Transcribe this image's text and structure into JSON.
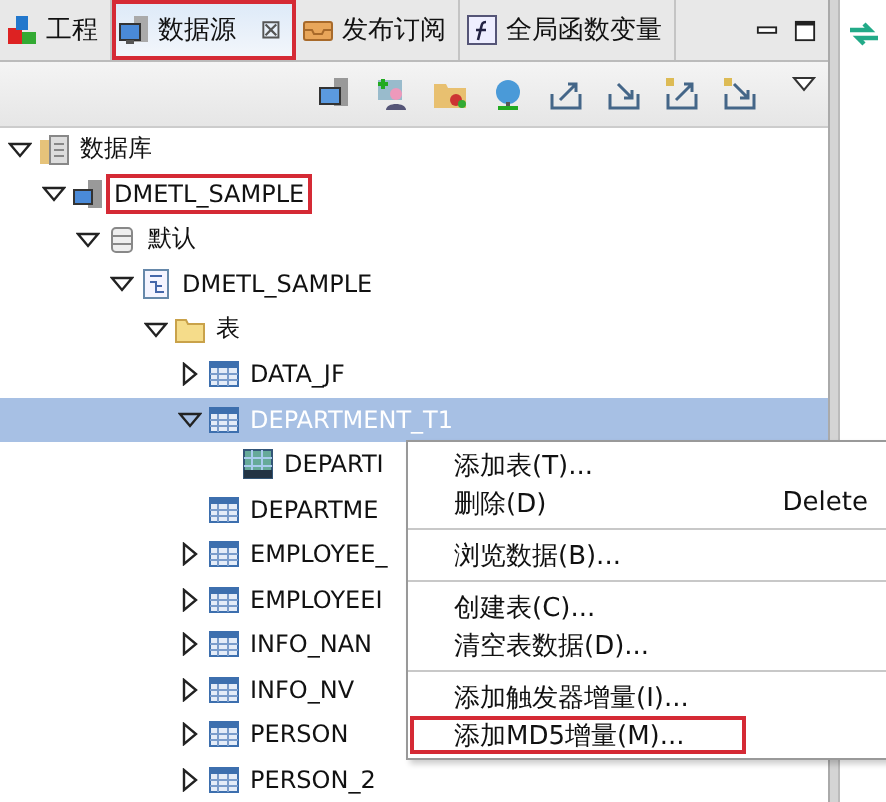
{
  "tabs": [
    {
      "label": "工程",
      "selected": false,
      "highlighted": false
    },
    {
      "label": "数据源",
      "selected": true,
      "highlighted": true,
      "close": "⊠"
    },
    {
      "label": "发布订阅",
      "selected": false,
      "highlighted": false
    },
    {
      "label": "全局函数变量",
      "selected": false,
      "highlighted": false
    }
  ],
  "tree": [
    {
      "label": "数据库",
      "kind": "database",
      "expanded": true,
      "selected": false,
      "highlighted": false,
      "children": [
        {
          "label": "DMETL_SAMPLE",
          "kind": "server",
          "expanded": true,
          "selected": false,
          "highlighted": true,
          "children": [
            {
              "label": "默认",
              "kind": "catalog",
              "expanded": true,
              "selected": false,
              "highlighted": false,
              "children": [
                {
                  "label": "DMETL_SAMPLE",
                  "kind": "schema",
                  "expanded": true,
                  "selected": false,
                  "highlighted": false,
                  "children": [
                    {
                      "label": "表",
                      "kind": "folder",
                      "expanded": true,
                      "selected": false,
                      "highlighted": false,
                      "children": [
                        {
                          "label": "DATA_JF",
                          "kind": "table",
                          "expanded": false,
                          "selected": false,
                          "highlighted": false
                        },
                        {
                          "label": "DEPARTMENT_T1",
                          "kind": "table",
                          "expanded": true,
                          "selected": true,
                          "highlighted": false,
                          "children": [
                            {
                              "label": "DEPARTI",
                              "kind": "md5",
                              "selected": false,
                              "highlighted": false
                            }
                          ]
                        },
                        {
                          "label": "DEPARTME",
                          "kind": "table",
                          "selected": false,
                          "highlighted": false
                        },
                        {
                          "label": "EMPLOYEE_",
                          "kind": "table",
                          "expanded": false,
                          "selected": false,
                          "highlighted": false
                        },
                        {
                          "label": "EMPLOYEEI",
                          "kind": "table",
                          "expanded": false,
                          "selected": false,
                          "highlighted": false
                        },
                        {
                          "label": "INFO_NAN",
                          "kind": "table",
                          "expanded": false,
                          "selected": false,
                          "highlighted": false
                        },
                        {
                          "label": "INFO_NV",
                          "kind": "table",
                          "expanded": false,
                          "selected": false,
                          "highlighted": false
                        },
                        {
                          "label": "PERSON",
                          "kind": "table",
                          "expanded": false,
                          "selected": false,
                          "highlighted": false
                        },
                        {
                          "label": "PERSON_2",
                          "kind": "table",
                          "expanded": false,
                          "selected": false,
                          "highlighted": false
                        }
                      ]
                    }
                  ]
                }
              ]
            }
          ]
        }
      ]
    }
  ],
  "context_menu": {
    "items": [
      {
        "kind": "item",
        "label": "添加表(T)...",
        "highlighted": false
      },
      {
        "kind": "item",
        "label": "删除(D)",
        "shortcut": "Delete",
        "highlighted": false
      },
      {
        "kind": "separator"
      },
      {
        "kind": "item",
        "label": "浏览数据(B)...",
        "highlighted": false
      },
      {
        "kind": "separator"
      },
      {
        "kind": "item",
        "label": "创建表(C)...",
        "highlighted": false
      },
      {
        "kind": "item",
        "label": "清空表数据(D)...",
        "highlighted": false
      },
      {
        "kind": "separator"
      },
      {
        "kind": "item",
        "label": "添加触发器增量(I)...",
        "highlighted": false
      },
      {
        "kind": "item",
        "label": "添加MD5增量(M)...",
        "highlighted": true
      }
    ]
  }
}
